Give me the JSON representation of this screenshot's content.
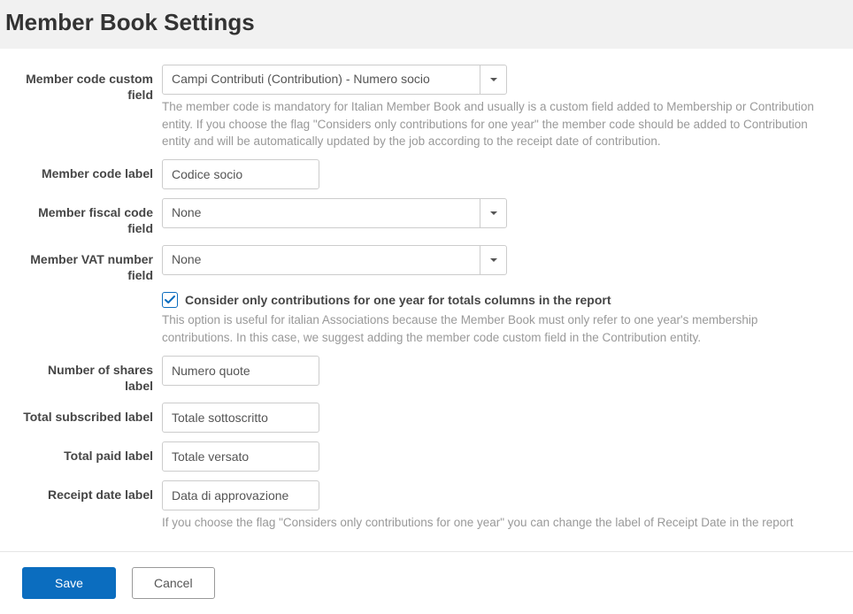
{
  "page": {
    "title": "Member Book Settings"
  },
  "fields": {
    "member_code_custom_field": {
      "label": "Member code custom field",
      "value": "Campi Contributi (Contribution) - Numero socio",
      "help": "The member code is mandatory for Italian Member Book and usually is a custom field added to Membership or Contribution entity. If you choose the flag \"Considers only contributions for one year\" the member code should be added to Contribution entity and will be automatically updated by the job according to the receipt date of contribution."
    },
    "member_code_label": {
      "label": "Member code label",
      "value": "Codice socio"
    },
    "member_fiscal_code_field": {
      "label": "Member fiscal code field",
      "value": "None"
    },
    "member_vat_number_field": {
      "label": "Member VAT number field",
      "value": "None"
    },
    "consider_one_year": {
      "checked": true,
      "label": "Consider only contributions for one year for totals columns in the report",
      "help": "This option is useful for italian Associations because the Member Book must only refer to one year's membership contributions. In this case, we suggest adding the member code custom field in the Contribution entity."
    },
    "number_of_shares_label": {
      "label": "Number of shares label",
      "value": "Numero quote"
    },
    "total_subscribed_label": {
      "label": "Total subscribed label",
      "value": "Totale sottoscritto"
    },
    "total_paid_label": {
      "label": "Total paid label",
      "value": "Totale versato"
    },
    "receipt_date_label": {
      "label": "Receipt date label",
      "value": "Data di approvazione",
      "help": "If you choose the flag \"Considers only contributions for one year\" you can change the label of Receipt Date in the report"
    }
  },
  "buttons": {
    "save": "Save",
    "cancel": "Cancel"
  }
}
